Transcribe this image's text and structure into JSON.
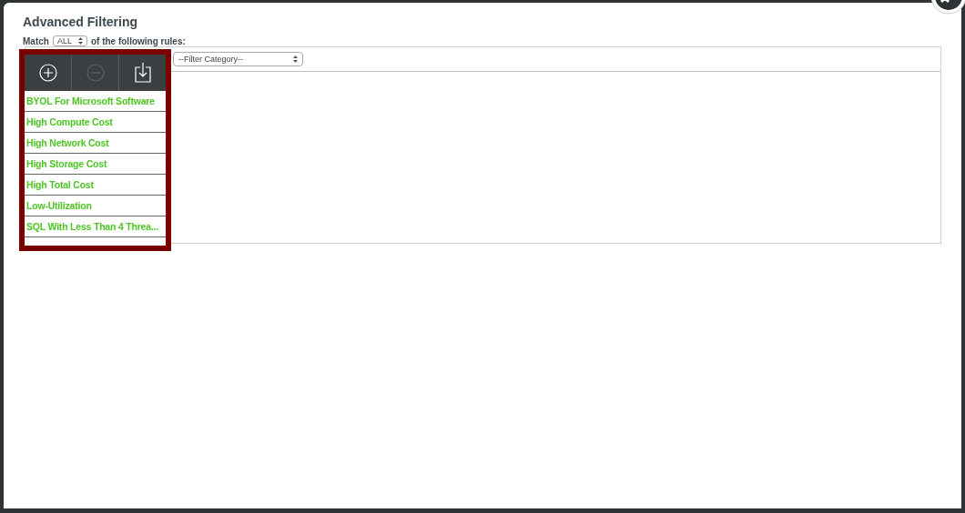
{
  "dialog": {
    "title": "Advanced Filtering",
    "match": {
      "prefix": "Match",
      "value": "ALL",
      "suffix": "of the following rules:"
    },
    "filter_category": {
      "value": "--Filter Category--"
    },
    "rule_menu": {
      "toolbar": [
        {
          "kind": "add",
          "disabled": false
        },
        {
          "kind": "remove",
          "disabled": true
        },
        {
          "kind": "import",
          "disabled": false
        }
      ],
      "items": [
        "BYOL For Microsoft Software",
        "High Compute Cost",
        "High Network Cost",
        "High Storage Cost",
        "High Total Cost",
        "Low-Utilization",
        "SQL With Less Than 4 Threa..."
      ]
    }
  }
}
